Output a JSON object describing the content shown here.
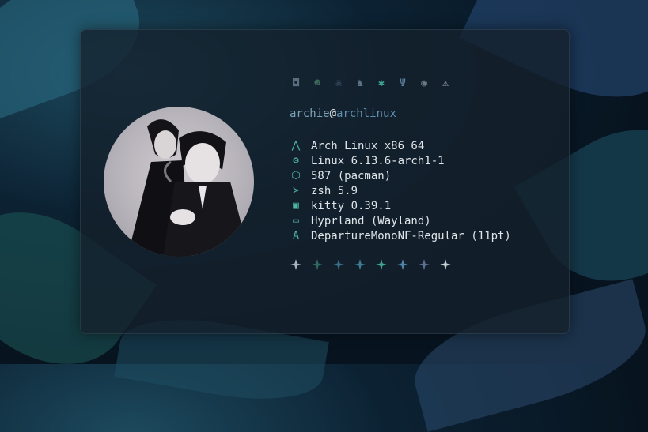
{
  "header_icons": [
    {
      "name": "ghost-icon",
      "glyph": "◘",
      "color": "#5b6e80"
    },
    {
      "name": "smiley-icon",
      "glyph": "☻",
      "color": "#3e6a5a"
    },
    {
      "name": "skull-icon",
      "glyph": "☠",
      "color": "#4b5f74"
    },
    {
      "name": "rabbit-icon",
      "glyph": "♞",
      "color": "#5d7484"
    },
    {
      "name": "bug-icon",
      "glyph": "✱",
      "color": "#3aa58f"
    },
    {
      "name": "trident-icon",
      "glyph": "Ψ",
      "color": "#5b7f9a"
    },
    {
      "name": "alien-icon",
      "glyph": "◉",
      "color": "#6a7a88"
    },
    {
      "name": "warning-icon",
      "glyph": "⚠",
      "color": "#aab4bc"
    }
  ],
  "title": {
    "user": "archie",
    "at": "@",
    "host": "archlinux"
  },
  "info": [
    {
      "icon": "arch-icon",
      "glyph": "⋀",
      "text": "Arch Linux x86_64"
    },
    {
      "icon": "gear-icon",
      "glyph": "⚙",
      "text": "Linux 6.13.6-arch1-1"
    },
    {
      "icon": "package-icon",
      "glyph": "⬡",
      "text": "587 (pacman)"
    },
    {
      "icon": "shell-prompt-icon",
      "glyph": "≻",
      "text": "zsh 5.9"
    },
    {
      "icon": "terminal-icon",
      "glyph": "▣",
      "text": "kitty 0.39.1"
    },
    {
      "icon": "window-icon",
      "glyph": "▭",
      "text": "Hyprland (Wayland)"
    },
    {
      "icon": "font-icon",
      "glyph": "A",
      "text": "DepartureMonoNF-Regular (11pt)"
    }
  ],
  "stars": [
    {
      "color": "#aab4bc"
    },
    {
      "color": "#2f6a5e"
    },
    {
      "color": "#3a6f87"
    },
    {
      "color": "#3f7a94"
    },
    {
      "color": "#3fa88e"
    },
    {
      "color": "#4e86a8"
    },
    {
      "color": "#5c6f92"
    },
    {
      "color": "#c7ced4"
    }
  ]
}
